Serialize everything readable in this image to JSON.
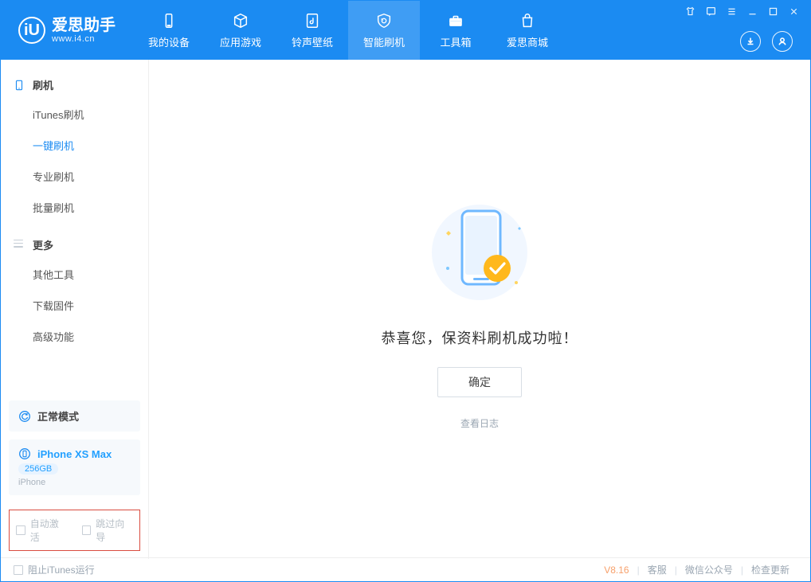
{
  "app": {
    "title": "爱思助手",
    "subtitle": "www.i4.cn"
  },
  "tabs": [
    {
      "label": "我的设备"
    },
    {
      "label": "应用游戏"
    },
    {
      "label": "铃声壁纸"
    },
    {
      "label": "智能刷机"
    },
    {
      "label": "工具箱"
    },
    {
      "label": "爱思商城"
    }
  ],
  "sidebar": {
    "group1": {
      "title": "刷机",
      "items": [
        {
          "label": "iTunes刷机"
        },
        {
          "label": "一键刷机"
        },
        {
          "label": "专业刷机"
        },
        {
          "label": "批量刷机"
        }
      ]
    },
    "group2": {
      "title": "更多",
      "items": [
        {
          "label": "其他工具"
        },
        {
          "label": "下载固件"
        },
        {
          "label": "高级功能"
        }
      ]
    }
  },
  "mode_card": {
    "label": "正常模式"
  },
  "device_card": {
    "name": "iPhone XS Max",
    "capacity": "256GB",
    "type": "iPhone"
  },
  "options": {
    "auto_activate": "自动激活",
    "skip_wizard": "跳过向导"
  },
  "main": {
    "message": "恭喜您，保资料刷机成功啦！",
    "confirm": "确定",
    "view_log": "查看日志"
  },
  "footer": {
    "block_itunes": "阻止iTunes运行",
    "version": "V8.16",
    "support": "客服",
    "wechat": "微信公众号",
    "check_update": "检查更新"
  }
}
